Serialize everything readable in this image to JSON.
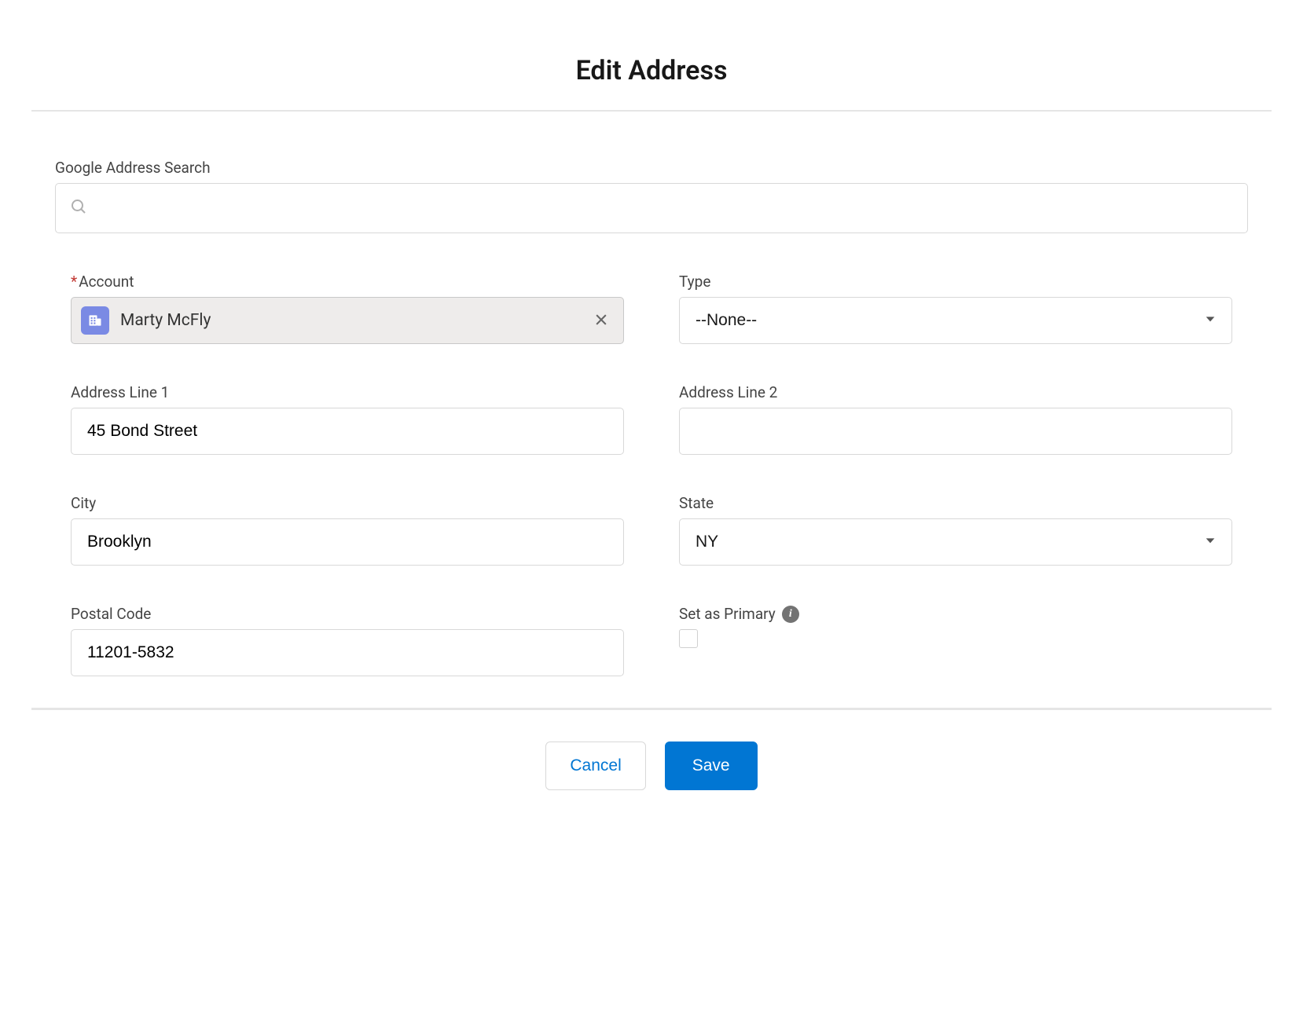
{
  "header": {
    "title": "Edit Address"
  },
  "search": {
    "label": "Google Address Search",
    "value": ""
  },
  "fields": {
    "account": {
      "label": "Account",
      "required_marker": "*",
      "value": "Marty McFly"
    },
    "type": {
      "label": "Type",
      "value": "--None--"
    },
    "address1": {
      "label": "Address Line 1",
      "value": "45 Bond Street"
    },
    "address2": {
      "label": "Address Line 2",
      "value": ""
    },
    "city": {
      "label": "City",
      "value": "Brooklyn"
    },
    "state": {
      "label": "State",
      "value": "NY"
    },
    "postal": {
      "label": "Postal Code",
      "value": "11201-5832"
    },
    "primary": {
      "label": "Set as Primary",
      "checked": false
    }
  },
  "footer": {
    "cancel": "Cancel",
    "save": "Save"
  }
}
